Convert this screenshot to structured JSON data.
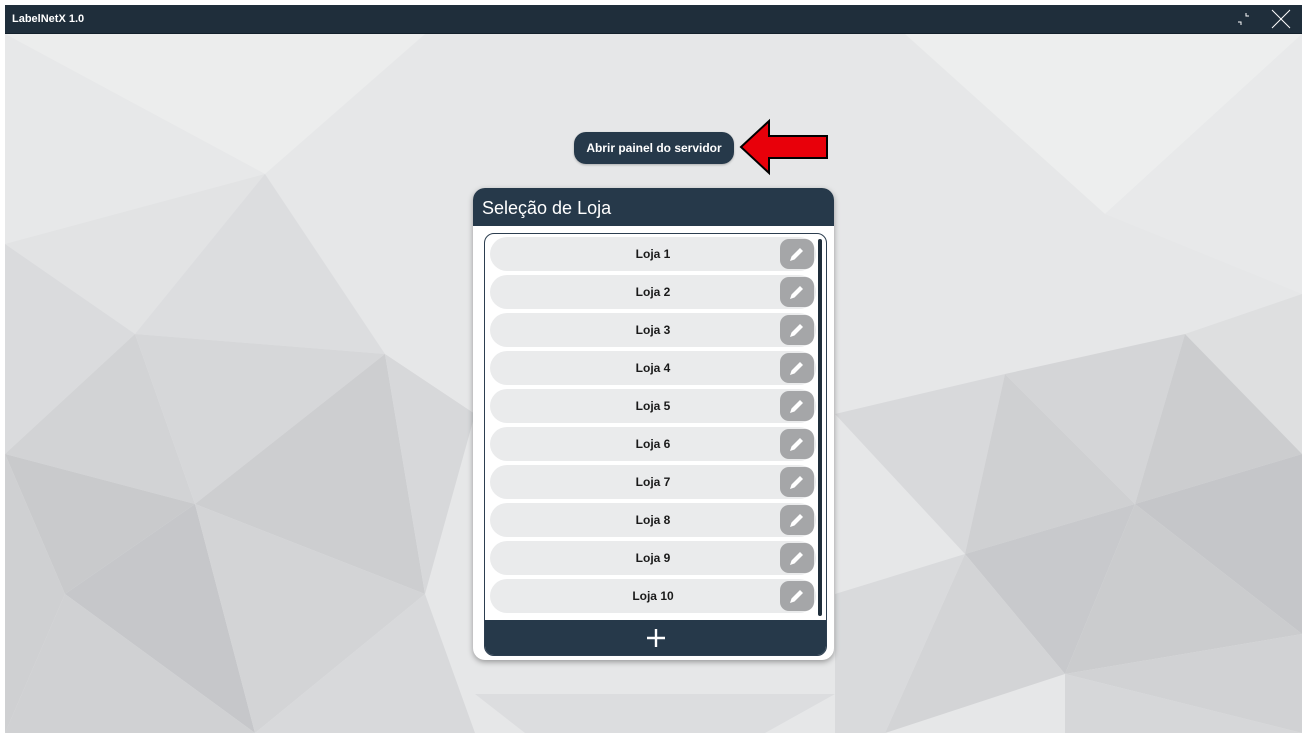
{
  "window": {
    "title": "LabelNetX 1.0",
    "controls": {
      "restore_icon": "restore-icon",
      "close_icon": "close-icon"
    }
  },
  "server_button": {
    "label": "Abrir painel do servidor"
  },
  "annotation": {
    "icon": "red-arrow-left-icon",
    "color": "#e8000a"
  },
  "store_panel": {
    "title": "Seleção de Loja",
    "stores": [
      {
        "label": "Loja 1"
      },
      {
        "label": "Loja 2"
      },
      {
        "label": "Loja 3"
      },
      {
        "label": "Loja 4"
      },
      {
        "label": "Loja 5"
      },
      {
        "label": "Loja 6"
      },
      {
        "label": "Loja 7"
      },
      {
        "label": "Loja 8"
      },
      {
        "label": "Loja 9"
      },
      {
        "label": "Loja 10"
      }
    ],
    "edit_icon": "pencil-icon",
    "add_icon": "plus-icon"
  },
  "colors": {
    "title_bar": "#1f2e3b",
    "accent": "#26394a",
    "row_bg": "#eaebec",
    "edit_button": "#a5a6a8",
    "background": "#e4e5e6"
  }
}
